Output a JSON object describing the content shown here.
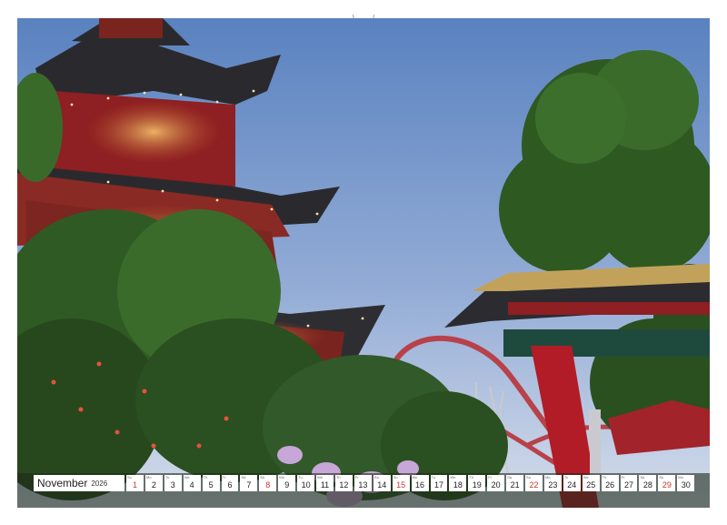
{
  "calendar": {
    "month": "November",
    "year": "2026",
    "days": [
      {
        "n": "1",
        "d": "Su",
        "sun": true
      },
      {
        "n": "2",
        "d": "Mo"
      },
      {
        "n": "3",
        "d": "Tu"
      },
      {
        "n": "4",
        "d": "We"
      },
      {
        "n": "5",
        "d": "Th"
      },
      {
        "n": "6",
        "d": "Fr"
      },
      {
        "n": "7",
        "d": "Sa"
      },
      {
        "n": "8",
        "d": "Su",
        "sun": true
      },
      {
        "n": "9",
        "d": "Mo"
      },
      {
        "n": "10",
        "d": "Tu"
      },
      {
        "n": "11",
        "d": "We"
      },
      {
        "n": "12",
        "d": "Th"
      },
      {
        "n": "13",
        "d": "Fr"
      },
      {
        "n": "14",
        "d": "Sa"
      },
      {
        "n": "15",
        "d": "Su",
        "sun": true
      },
      {
        "n": "16",
        "d": "Mo"
      },
      {
        "n": "17",
        "d": "Tu"
      },
      {
        "n": "18",
        "d": "We"
      },
      {
        "n": "19",
        "d": "Th"
      },
      {
        "n": "20",
        "d": "Fr"
      },
      {
        "n": "21",
        "d": "Sa"
      },
      {
        "n": "22",
        "d": "Su",
        "sun": true
      },
      {
        "n": "23",
        "d": "Mo"
      },
      {
        "n": "24",
        "d": "Tu"
      },
      {
        "n": "25",
        "d": "We"
      },
      {
        "n": "26",
        "d": "Th"
      },
      {
        "n": "27",
        "d": "Fr"
      },
      {
        "n": "28",
        "d": "Sa"
      },
      {
        "n": "29",
        "d": "Su",
        "sun": true
      },
      {
        "n": "30",
        "d": "Mo"
      }
    ]
  },
  "colors": {
    "sky_top": "#5f86c2",
    "sky_bottom": "#c9d6ea",
    "pagoda_red": "#8e1f22",
    "roof_dark": "#2a2a2e",
    "foliage": "#2f5a24",
    "sunday": "#c0392b"
  }
}
